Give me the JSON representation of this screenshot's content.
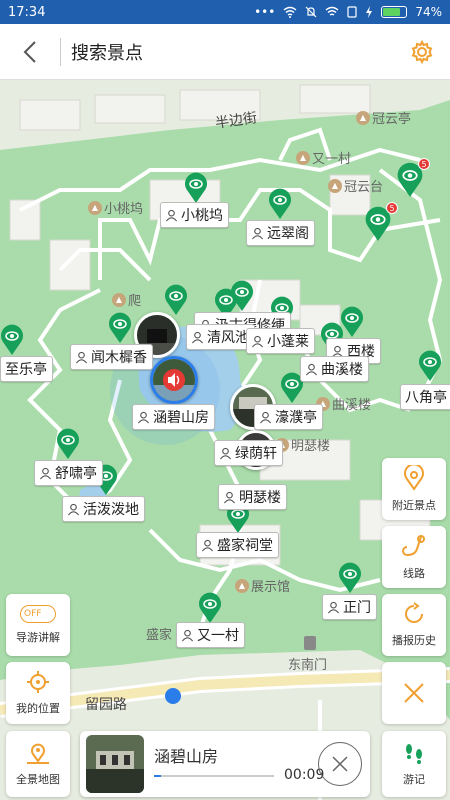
{
  "status_bar": {
    "time": "17:34",
    "dots": "•••",
    "battery_percent": "74%",
    "battery_level": 0.74
  },
  "header": {
    "title": "搜索景点"
  },
  "map": {
    "streets": {
      "banbianjie": "半边街",
      "liuyuanlu": "留园路"
    },
    "pois": {
      "guanyunting": "冠云亭",
      "youyicun": "又一村",
      "guanyuntai": "冠云台",
      "xiaotaowu": "小桃坞",
      "pa": "爬",
      "xiaopenglai": "小蓬莱",
      "quxilou": "曲溪楼",
      "mingselou": "明瑟楼",
      "zhanshiguan": "展示馆",
      "shengjia": "盛家",
      "dongnanmen": "东南门",
      "xianqiaojin": "远翠阁"
    },
    "labels": {
      "xiaotaowu": "小桃坞",
      "yuancuige": "远翠阁",
      "jiguxiugeng": "汲古得修绠",
      "qingfeng": "清风池",
      "xiaopenglai": "小蓬莱",
      "wenmuxi": "闻木樨香",
      "zhile": "至乐亭",
      "xilou": "西楼",
      "quxilou": "曲溪楼",
      "ba": "八角亭",
      "hanbi": "涵碧山房",
      "haopu": "濠濮亭",
      "lvyin": "绿荫轩",
      "shuxiao": "舒啸亭",
      "mingse": "明瑟楼",
      "huopopo": "活泼泼地",
      "shengjia": "盛家祠堂",
      "zhengmen": "正门",
      "youyi": "又一村"
    },
    "badges": {
      "a": "5",
      "b": "5"
    }
  },
  "buttons": {
    "nearby": "附近景点",
    "route": "线路",
    "history": "播报历史",
    "guide": "导游讲解",
    "guide_toggle": "OFF",
    "mylocation": "我的位置",
    "fullmap": "全景地图",
    "footprint": "游记"
  },
  "player": {
    "name": "涵碧山房",
    "time": "00:09",
    "progress": 0.06
  },
  "colors": {
    "accent": "#2b7de9",
    "pin_green": "#17a05a",
    "orange": "#f0a030",
    "status_bar": "#1f5fae"
  }
}
